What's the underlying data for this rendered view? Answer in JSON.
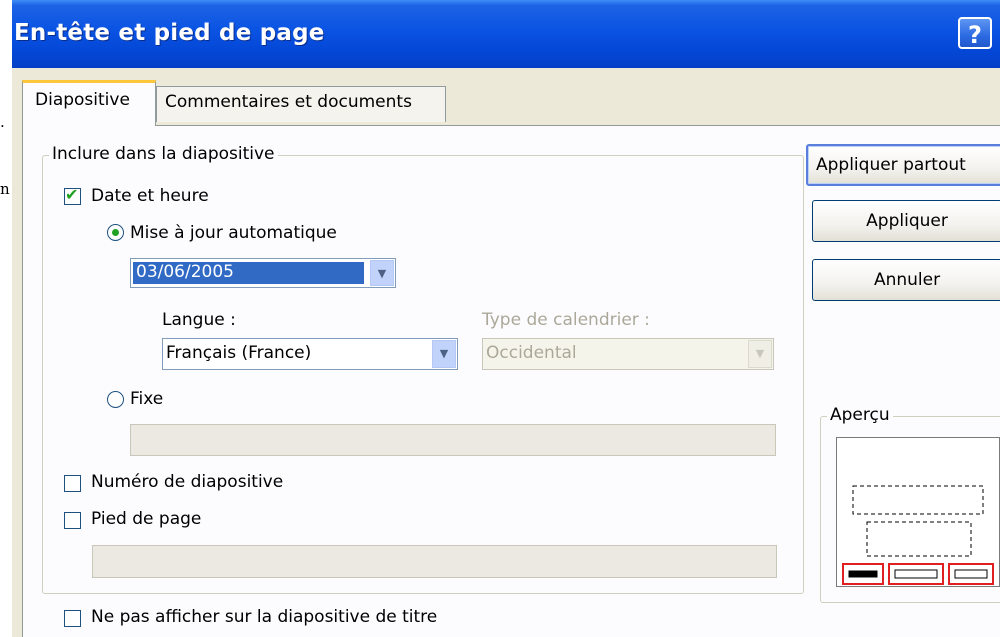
{
  "side_chars": [
    ".",
    "n"
  ],
  "dialog": {
    "title": "En-tête et pied de page",
    "help_label": "?"
  },
  "tabs": [
    {
      "label": "Diapositive",
      "active": true
    },
    {
      "label": "Commentaires et documents",
      "active": false
    }
  ],
  "group": {
    "legend": "Inclure dans la diapositive",
    "date_time": {
      "label": "Date et heure",
      "checked": true
    },
    "auto_update": {
      "label": "Mise à jour automatique",
      "selected": true
    },
    "date_value": "03/06/2005",
    "language": {
      "label": "Langue :",
      "value": "Français (France)"
    },
    "calendar": {
      "label": "Type de calendrier :",
      "value": "Occidental"
    },
    "fixed": {
      "label": "Fixe",
      "selected": false,
      "value": ""
    },
    "slide_number": {
      "label": "Numéro de diapositive",
      "checked": false
    },
    "footer": {
      "label": "Pied de page",
      "checked": false,
      "value": ""
    }
  },
  "hide_on_title": {
    "label": "Ne pas afficher sur la diapositive de titre",
    "checked": false
  },
  "buttons": {
    "apply_all": "Appliquer partout",
    "apply": "Appliquer",
    "cancel": "Annuler"
  },
  "preview": {
    "legend": "Aperçu"
  },
  "colors": {
    "titlebar": "#0a53e3",
    "selection": "#316ac5",
    "check": "#21a121"
  }
}
